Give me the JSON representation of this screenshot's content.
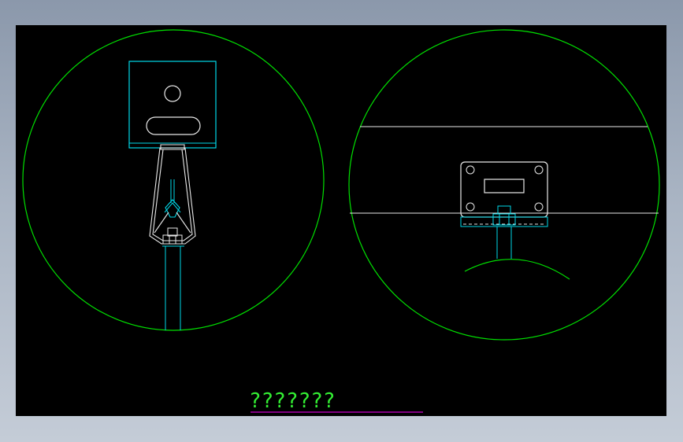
{
  "drawing": {
    "title": "???????",
    "colors": {
      "background": "#000000",
      "outline_green": "#00e000",
      "part_cyan": "#00d8e8",
      "line_white": "#e8e8e8",
      "title_green": "#33ee33",
      "underline_magenta": "#cc00cc"
    }
  }
}
